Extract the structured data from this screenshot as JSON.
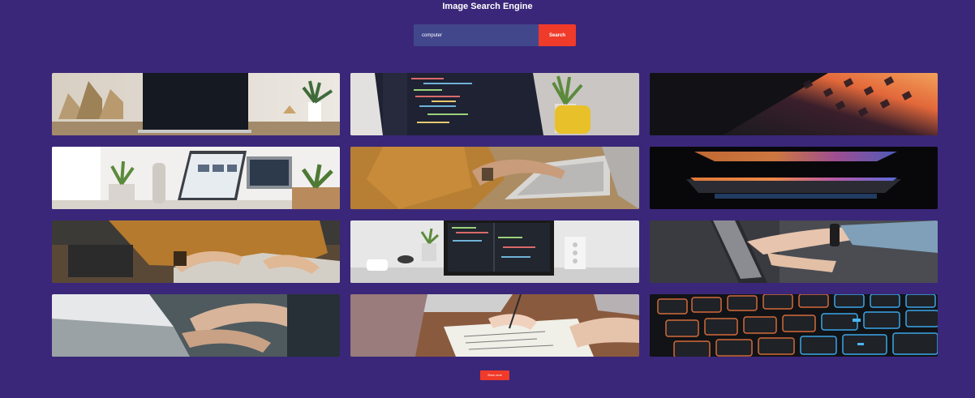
{
  "app": {
    "title": "Image Search Engine"
  },
  "search": {
    "value": "computer",
    "button_label": "Search"
  },
  "results": [
    {
      "name": "laptop-on-desk-with-plant"
    },
    {
      "name": "laptop-code-editor-plant-mug"
    },
    {
      "name": "laptop-keyboard-neon-glow"
    },
    {
      "name": "laptop-browser-plants-bright-room"
    },
    {
      "name": "hands-typing-on-laptop"
    },
    {
      "name": "laptop-edge-orange-blue-light"
    },
    {
      "name": "person-writing-at-desk"
    },
    {
      "name": "laptop-with-code-on-desk"
    },
    {
      "name": "hand-pointing-at-tablet"
    },
    {
      "name": "hands-typing-closeup"
    },
    {
      "name": "hands-writing-notes-laptop"
    },
    {
      "name": "backlit-keyboard-keys"
    }
  ],
  "show_more": {
    "label": "Show more"
  },
  "colors": {
    "background": "#3a2779",
    "input": "#42478c",
    "accent": "#f03a2a"
  }
}
